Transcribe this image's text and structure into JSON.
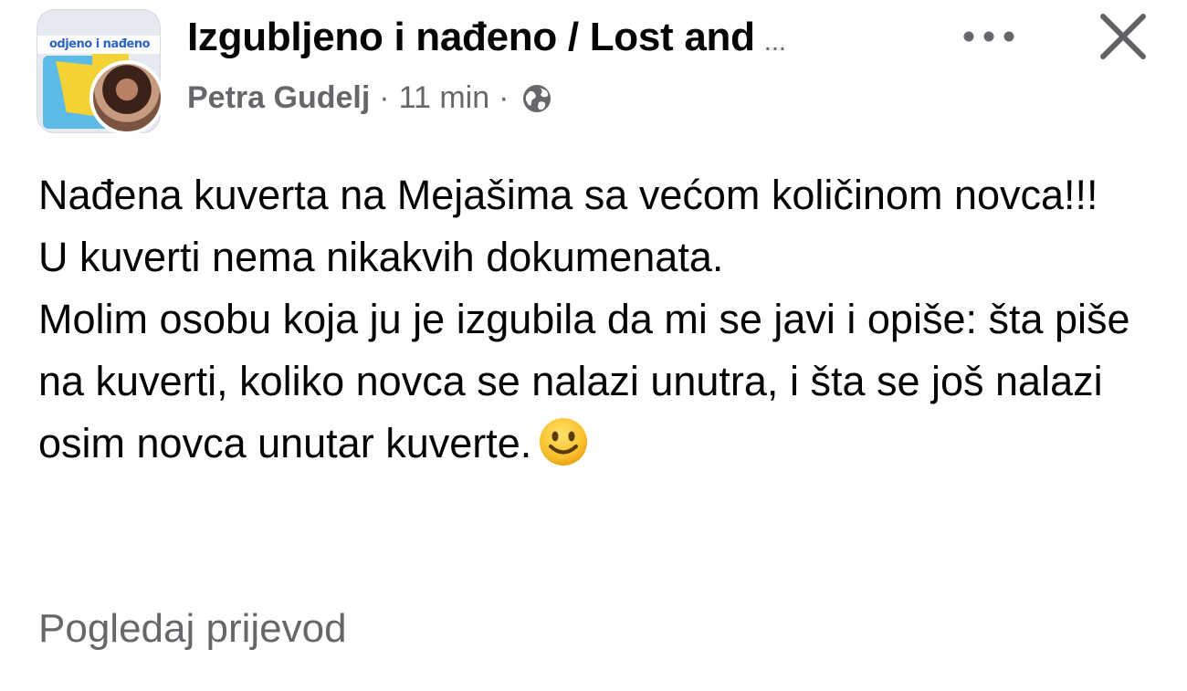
{
  "header": {
    "group_avatar_text": "odjeno i nađeno",
    "group_name": "Izgubljeno i nađeno / Lost and",
    "group_name_ellipsis": "...",
    "author": "Petra Gudelj",
    "separator_1": "·",
    "time": "11 min",
    "separator_2": "·",
    "privacy_icon": "globe-icon",
    "more_icon": "more-horizontal-icon",
    "close_icon": "close-icon"
  },
  "post": {
    "lines": [
      "Nađena kuverta na Mejašima sa većom količinom novca!!!",
      "U kuverti nema nikakvih dokumenata.",
      "Molim osobu koja ju je izgubila da mi se javi i opiše: šta piše na kuverti, koliko novca se nalazi unutra, i šta se još nalazi osim novca unutar kuverte."
    ],
    "emoji": "smiling-face-icon"
  },
  "footer": {
    "translate_label": "Pogledaj prijevod"
  },
  "colors": {
    "text": "#050505",
    "secondary": "#65676b"
  }
}
